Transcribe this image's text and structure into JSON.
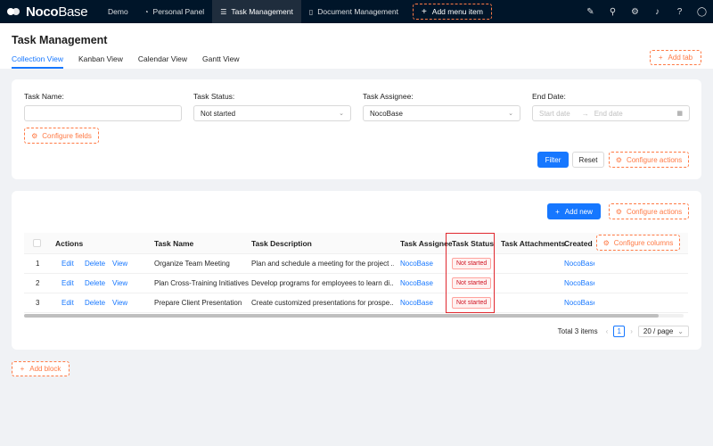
{
  "topbar": {
    "logo": {
      "bold": "Noco",
      "thin": "Base"
    },
    "nav": [
      {
        "label": "Demo",
        "icon": ""
      },
      {
        "label": "Personal Panel",
        "icon": "dashboard-icon"
      },
      {
        "label": "Task Management",
        "icon": "list-icon"
      },
      {
        "label": "Document Management",
        "icon": "file-icon"
      }
    ],
    "add_menu_label": "Add menu item",
    "icons": [
      "paint-brush-icon",
      "plugin-icon",
      "settings-icon",
      "bell-icon",
      "help-icon",
      "user-icon"
    ]
  },
  "page": {
    "title": "Task Management",
    "tabs": [
      "Collection View",
      "Kanban View",
      "Calendar View",
      "Gantt View"
    ],
    "add_tab_label": "Add tab"
  },
  "filter": {
    "fields": [
      {
        "label": "Task Name:",
        "value": "",
        "placeholder": ""
      },
      {
        "label": "Task Status:",
        "value": "Not started"
      },
      {
        "label": "Task Assignee:",
        "value": "NocoBase"
      },
      {
        "label": "End Date:",
        "start_placeholder": "Start date",
        "end_placeholder": "End date"
      }
    ],
    "configure_fields_label": "Configure fields",
    "filter_label": "Filter",
    "reset_label": "Reset",
    "configure_actions_label": "Configure actions"
  },
  "table": {
    "add_new_label": "Add new",
    "configure_actions_label": "Configure actions",
    "configure_columns_label": "Configure columns",
    "columns": [
      "Actions",
      "Task Name",
      "Task Description",
      "Task Assignee",
      "Task Status",
      "Task Attachments",
      "Created b"
    ],
    "row_actions": {
      "edit": "Edit",
      "delete": "Delete",
      "view": "View"
    },
    "rows": [
      {
        "index": "1",
        "name": "Organize Team Meeting",
        "description": "Plan and schedule a meeting for the project ...",
        "assignee": "NocoBase",
        "status": "Not started",
        "created_by": "NocoBase"
      },
      {
        "index": "2",
        "name": "Plan Cross-Training Initiatives",
        "description": "Develop programs for employees to learn di...",
        "assignee": "NocoBase",
        "status": "Not started",
        "created_by": "NocoBase"
      },
      {
        "index": "3",
        "name": "Prepare Client Presentation",
        "description": "Create customized presentations for prospe...",
        "assignee": "NocoBase",
        "status": "Not started",
        "created_by": "NocoBase"
      }
    ],
    "pagination": {
      "total": "Total 3 items",
      "current_page": "1",
      "page_size": "20 / page"
    }
  },
  "add_block_label": "Add block"
}
